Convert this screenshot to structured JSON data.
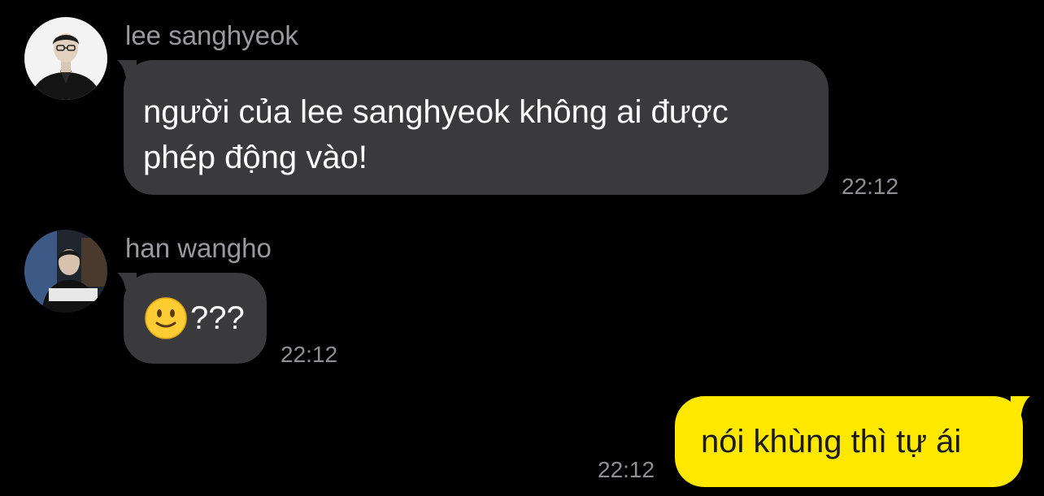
{
  "messages": [
    {
      "sender": "lee sanghyeok",
      "text": "người của lee sanghyeok không ai được\nphép động vào!",
      "time": "22:12",
      "avatar_icon": "person-avatar-icon"
    },
    {
      "sender": "han wangho",
      "emoji": "slightly-smiling-face-emoji",
      "text": "???",
      "time": "22:12",
      "avatar_icon": "person-avatar-icon"
    },
    {
      "text": "nói khùng thì tự ái",
      "time": "22:12"
    }
  ],
  "colors": {
    "background": "#000000",
    "incoming_bubble": "#3a3a3c",
    "outgoing_bubble": "#ffe800",
    "meta_text": "#9a9a9e"
  }
}
